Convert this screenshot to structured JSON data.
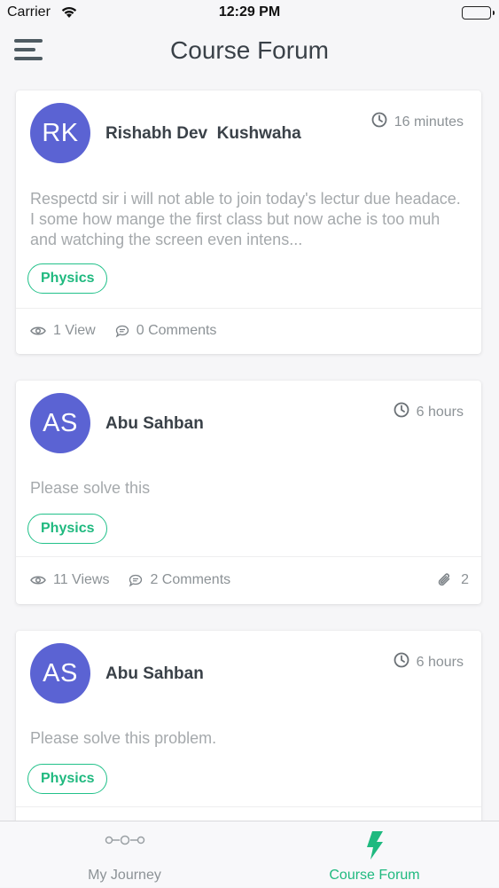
{
  "status_bar": {
    "carrier": "Carrier",
    "time": "12:29 PM"
  },
  "header": {
    "title": "Course Forum",
    "menu_icon": "hamburger-menu-icon"
  },
  "posts": [
    {
      "initials": "RK",
      "author": "Rishabh Dev  Kushwaha",
      "time": "16 minutes",
      "body": "Respectd sir  i will not able to join today's lectur due headace. I some how mange the first class but now ache is too muh and watching the screen even intens...",
      "tag": "Physics",
      "views": "1 View",
      "comments": "0 Comments",
      "attachments": ""
    },
    {
      "initials": "AS",
      "author": "Abu Sahban",
      "time": "6 hours",
      "body": "Please solve this",
      "tag": "Physics",
      "views": "11 Views",
      "comments": "2 Comments",
      "attachments": "2"
    },
    {
      "initials": "AS",
      "author": "Abu Sahban",
      "time": "6 hours",
      "body": "Please solve this problem.",
      "tag": "Physics",
      "views": "",
      "comments": "",
      "attachments": ""
    }
  ],
  "tab_bar": {
    "tabs": [
      {
        "label": "My Journey",
        "icon": "journey-nodes-icon",
        "active": false
      },
      {
        "label": "Course Forum",
        "icon": "lightning-bolt-icon",
        "active": true
      }
    ]
  },
  "colors": {
    "accent": "#1fb97f",
    "avatar": "#5b63d3",
    "title": "#3a4148",
    "muted": "#8c9296"
  }
}
